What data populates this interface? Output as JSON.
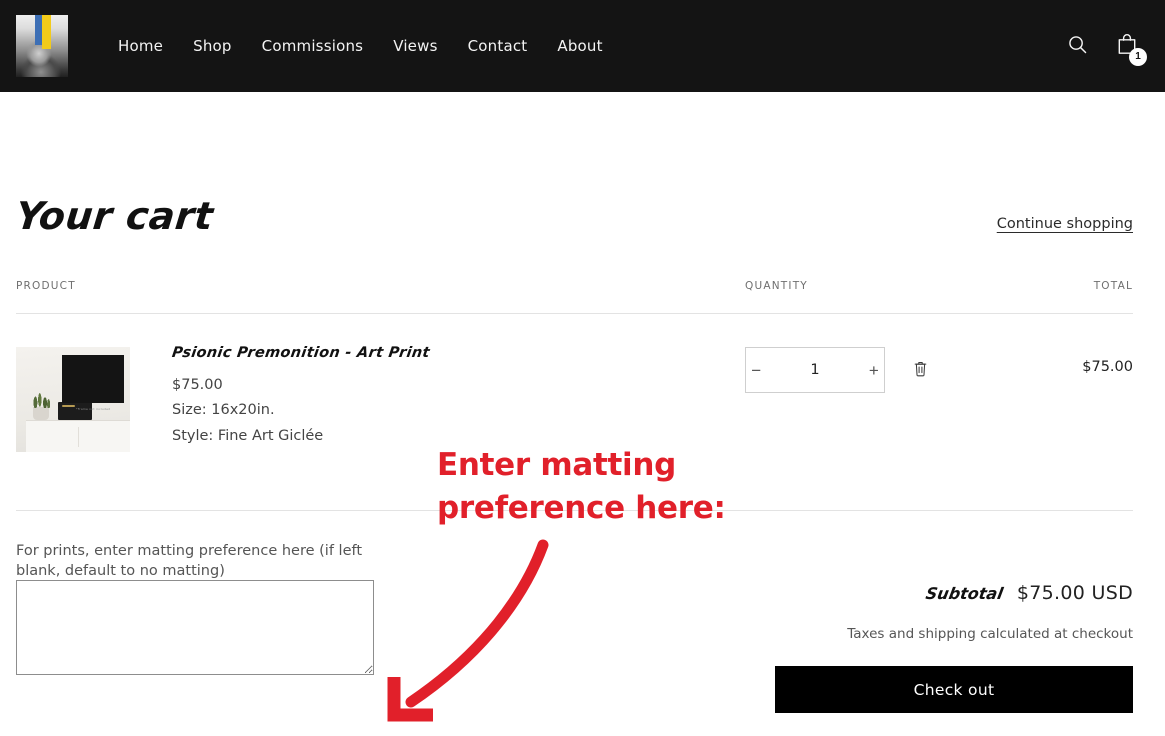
{
  "header": {
    "logo_alt": "artist-portrait-logo",
    "nav": [
      {
        "label": "Home"
      },
      {
        "label": "Shop"
      },
      {
        "label": "Commissions"
      },
      {
        "label": "Views"
      },
      {
        "label": "Contact"
      },
      {
        "label": "About"
      }
    ],
    "search_icon": "search-icon",
    "cart_icon": "shopping-bag-icon",
    "cart_count": "1"
  },
  "cart": {
    "title": "Your cart",
    "continue_shopping": "Continue shopping",
    "columns": {
      "product": "PRODUCT",
      "quantity": "QUANTITY",
      "total": "TOTAL"
    },
    "items": [
      {
        "title": "Psionic Premonition - Art Print",
        "price": "$75.00",
        "size": "Size: 16x20in.",
        "style": "Style: Fine Art Giclée",
        "image_caption": "*Frame not included",
        "quantity": "1",
        "decrease_label": "−",
        "increase_label": "+",
        "remove_icon": "trash-icon",
        "line_total": "$75.00"
      }
    ],
    "note": {
      "label": "For prints, enter matting preference here (if left blank, default to no matting)",
      "value": "",
      "placeholder": ""
    },
    "summary": {
      "subtotal_label": "Subtotal",
      "subtotal_value": "$75.00 USD",
      "tax_note": "Taxes and shipping calculated at checkout",
      "checkout_label": "Check out"
    }
  },
  "annotation": {
    "text": "Enter matting\npreference here:",
    "color": "#e1202a",
    "arrow": "curved-arrow-down-left"
  },
  "colors": {
    "header_bg": "#141414",
    "page_bg": "#ffffff",
    "accent_red": "#e1202a",
    "button_black": "#000000",
    "rule": "#e3e3e3"
  }
}
